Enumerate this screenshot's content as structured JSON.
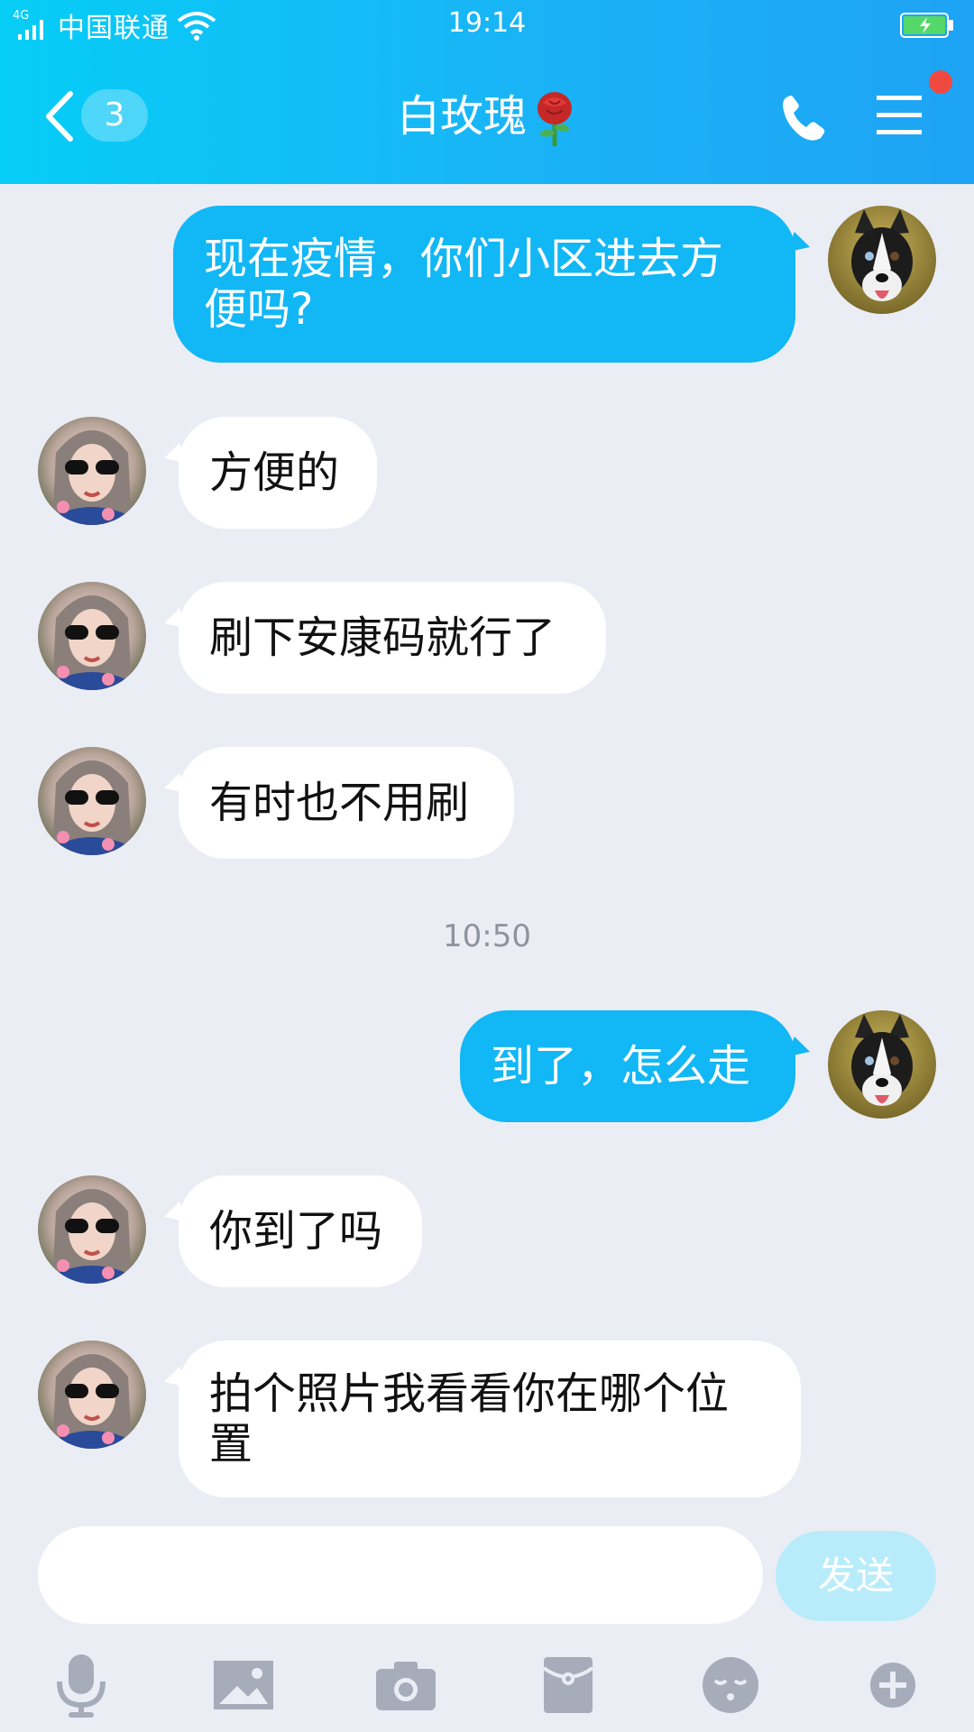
{
  "status_bar": {
    "network": "4G",
    "carrier": "中国联通",
    "time": "19:14"
  },
  "header": {
    "unread_count": "3",
    "title": "白玫瑰",
    "accent_color": "#12b7f5"
  },
  "messages": [
    {
      "side": "out",
      "text_line1": "现在疫情，你们小区进去方",
      "text_line2": "便吗?"
    },
    {
      "side": "in",
      "text": "方便的"
    },
    {
      "side": "in",
      "text": "刷下安康码就行了"
    },
    {
      "side": "in",
      "text": "有时也不用刷"
    },
    {
      "side": "out",
      "text": "到了，怎么走"
    },
    {
      "side": "in",
      "text": "你到了吗"
    },
    {
      "side": "in",
      "text_line1": "拍个照片我看看你在哪个位",
      "text_line2": "置"
    }
  ],
  "timestamp": "10:50",
  "composer": {
    "input_value": "",
    "send_label": "发送"
  },
  "toolbar_icons": [
    "microphone-icon",
    "image-icon",
    "camera-icon",
    "red-packet-icon",
    "emoji-icon",
    "plus-icon"
  ]
}
